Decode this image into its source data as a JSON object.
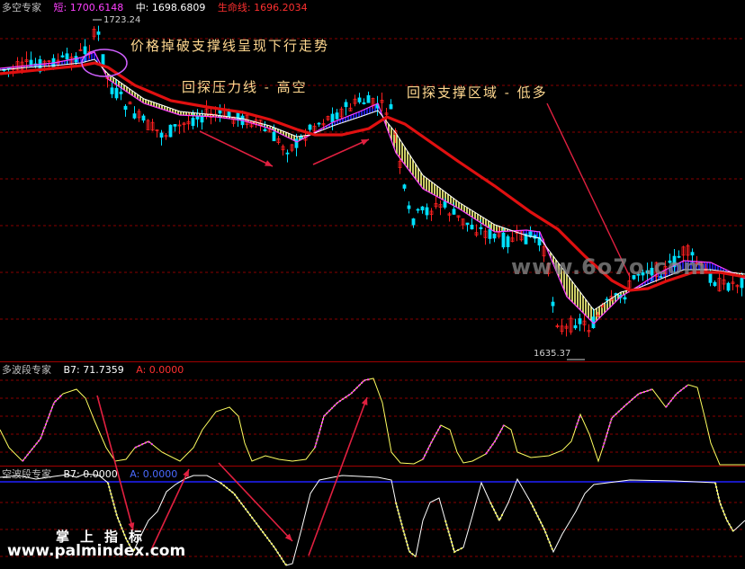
{
  "main_panel": {
    "title": "多空专家",
    "short_label": "短: 1700.6148",
    "mid_label": "中: 1698.6809",
    "life_label": "生命线: 1696.2034",
    "high_label": "1723.24",
    "low_label": "1635.37",
    "annotations": {
      "break_support": "价格掉破支撑线呈现下行走势",
      "retest_resistance": "回探压力线 - 高空",
      "retest_support": "回探支撑区域 - 低多"
    },
    "watermark": "www.6o7o.com"
  },
  "wave_panel_long": {
    "title": "多波段专家",
    "b7_label": "B7: 71.7359",
    "a_label": "A: 0.0000"
  },
  "wave_panel_short": {
    "title": "空波段专家",
    "b7_label": "B7: 0.0000",
    "a_label": "A: 0.0000"
  },
  "footer": {
    "brand_cn": "掌上指标",
    "brand_url": "www.palmindex.com"
  },
  "colors": {
    "background": "#000000",
    "life_line": "#e01010",
    "short_line": "#ff40ff",
    "mid_line": "#ffffff",
    "up_candle": "#ff2020",
    "down_candle": "#00e0ff",
    "fill_bear": "#ffff80",
    "fill_bull": "#2020ff",
    "wave_line": "#ffff60",
    "wave_purple": "#ff40ff",
    "annotation_arrow": "#e02040"
  }
}
